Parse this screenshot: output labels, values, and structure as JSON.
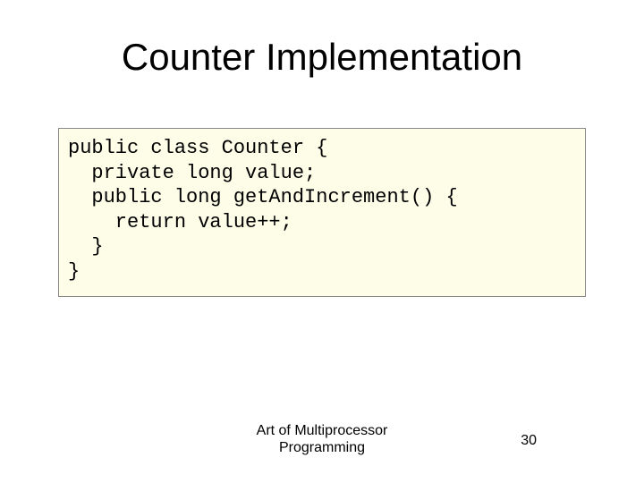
{
  "title": "Counter Implementation",
  "code": {
    "l1": "public class Counter {",
    "l2": "  private long value;",
    "l3": "",
    "l4": "  public long getAndIncrement() {",
    "l5": "    return value++;",
    "l6": "  }",
    "l7": "}"
  },
  "footer": {
    "line1": "Art of Multiprocessor",
    "line2": "Programming"
  },
  "page_number": "30"
}
